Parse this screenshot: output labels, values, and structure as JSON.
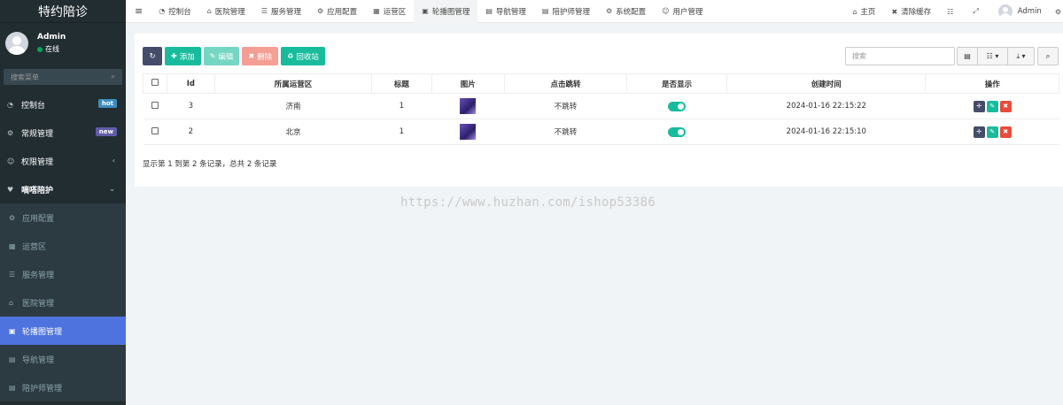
{
  "app": {
    "title": "特约陪诊"
  },
  "user": {
    "name": "Admin",
    "status": "在线"
  },
  "sidebar": {
    "search_placeholder": "搜索菜单",
    "menu": [
      {
        "label": "控制台",
        "icon": "dashboard-icon",
        "badge": "hot",
        "badge_color": "#3c8dbc"
      },
      {
        "label": "常规管理",
        "icon": "cogs-icon",
        "badge": "new",
        "badge_color": "#605ca8"
      },
      {
        "label": "权限管理",
        "icon": "group-icon"
      },
      {
        "label": "嘀嗒陪护",
        "icon": "heart-icon"
      }
    ],
    "submenu": [
      {
        "label": "应用配置",
        "icon": "gear-icon"
      },
      {
        "label": "运营区",
        "icon": "map-icon"
      },
      {
        "label": "服务管理",
        "icon": "list-icon"
      },
      {
        "label": "医院管理",
        "icon": "hospital-icon"
      },
      {
        "label": "轮播图管理",
        "icon": "image-icon",
        "active": true
      },
      {
        "label": "导航管理",
        "icon": "table-icon"
      },
      {
        "label": "陪护师管理",
        "icon": "id-card-icon"
      }
    ]
  },
  "topbar": {
    "tabs": [
      {
        "label": "控制台",
        "icon": "dashboard-icon"
      },
      {
        "label": "医院管理",
        "icon": "hospital-icon"
      },
      {
        "label": "服务管理",
        "icon": "list-icon"
      },
      {
        "label": "应用配置",
        "icon": "gear-icon"
      },
      {
        "label": "运营区",
        "icon": "map-icon"
      },
      {
        "label": "轮播图管理",
        "icon": "image-icon",
        "active": true
      },
      {
        "label": "导航管理",
        "icon": "table-icon"
      },
      {
        "label": "陪护师管理",
        "icon": "id-card-icon"
      },
      {
        "label": "系统配置",
        "icon": "gear-icon"
      },
      {
        "label": "用户管理",
        "icon": "user-icon"
      }
    ],
    "home": "主页",
    "clear_cache": "清除缓存",
    "admin": "Admin"
  },
  "toolbar": {
    "add": "添加",
    "edit": "编辑",
    "delete": "删除",
    "recycle": "回收站",
    "search_placeholder": "搜索"
  },
  "table": {
    "headers": [
      "Id",
      "所属运营区",
      "标题",
      "图片",
      "点击跳转",
      "是否显示",
      "创建时间",
      "操作"
    ],
    "rows": [
      {
        "id": "3",
        "region": "济南",
        "title": "1",
        "jump": "不跳转",
        "created": "2024-01-16 22:15:22"
      },
      {
        "id": "2",
        "region": "北京",
        "title": "1",
        "jump": "不跳转",
        "created": "2024-01-16 22:15:10"
      }
    ],
    "summary": "显示第 1 到第 2 条记录，总共 2 条记录"
  },
  "watermark": "https://www.huzhan.com/ishop53386",
  "colors": {
    "accent": "#4e73df",
    "sidebar_bg": "#222d32",
    "success": "#18bc9c",
    "danger": "#e74c3c"
  }
}
